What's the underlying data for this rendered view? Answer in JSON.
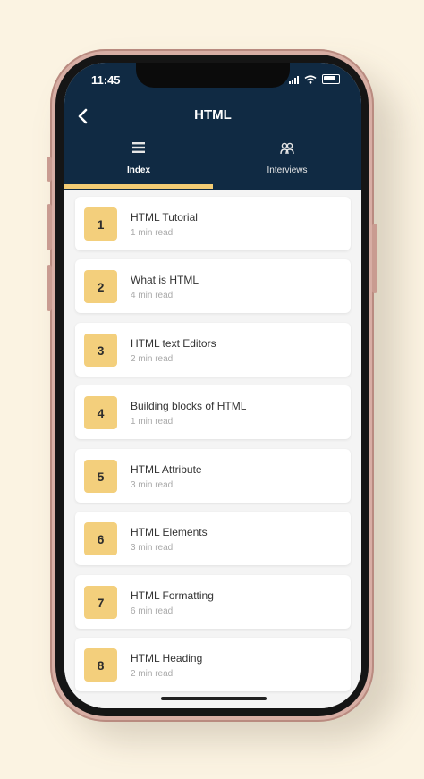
{
  "status_bar": {
    "time": "11:45"
  },
  "header": {
    "title": "HTML",
    "back_icon": "chevron-left-icon"
  },
  "tabs": [
    {
      "label": "Index",
      "icon": "list-icon",
      "active": true
    },
    {
      "label": "Interviews",
      "icon": "users-icon",
      "active": false
    }
  ],
  "colors": {
    "header_bg": "#102a43",
    "accent": "#f3cc74",
    "number_bg": "#f3cf7c",
    "page_bg": "#fbf3e2"
  },
  "lessons": [
    {
      "number": "1",
      "title": "HTML Tutorial",
      "read_time": "1 min read"
    },
    {
      "number": "2",
      "title": "What is HTML",
      "read_time": "4 min read"
    },
    {
      "number": "3",
      "title": "HTML text Editors",
      "read_time": "2 min read"
    },
    {
      "number": "4",
      "title": "Building blocks of HTML",
      "read_time": "1 min read"
    },
    {
      "number": "5",
      "title": "HTML Attribute",
      "read_time": "3 min read"
    },
    {
      "number": "6",
      "title": "HTML Elements",
      "read_time": "3 min read"
    },
    {
      "number": "7",
      "title": "HTML Formatting",
      "read_time": "6 min read"
    },
    {
      "number": "8",
      "title": "HTML Heading",
      "read_time": "2 min read"
    }
  ]
}
